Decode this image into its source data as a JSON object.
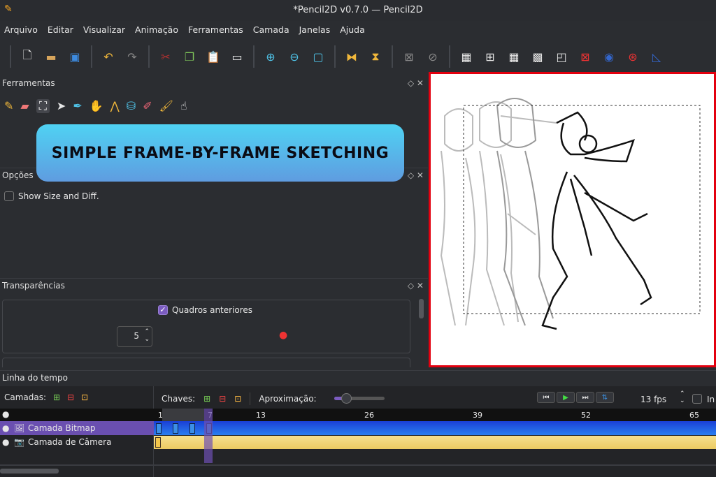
{
  "window": {
    "title": "*Pencil2D v0.7.0 — Pencil2D"
  },
  "menu": [
    "Arquivo",
    "Editar",
    "Visualizar",
    "Animação",
    "Ferramentas",
    "Camada",
    "Janelas",
    "Ajuda"
  ],
  "panels": {
    "tools": "Ferramentas",
    "options": "Opções",
    "transparency": "Transparências",
    "timeline": "Linha do tempo"
  },
  "banner": "SIMPLE FRAME-BY-FRAME SKETCHING",
  "options": {
    "show_size_diff": "Show Size and Diff."
  },
  "transparency": {
    "prev_frames": "Quadros anteriores",
    "prev_count": "5"
  },
  "timeline": {
    "layers_label": "Camadas:",
    "keys_label": "Chaves:",
    "zoom_label": "Aproximação:",
    "fps": "13 fps",
    "in_label": "In",
    "ruler": [
      "1",
      "7",
      "13",
      "26",
      "39",
      "52",
      "65"
    ],
    "layers": [
      "Camada Bitmap",
      "Camada de Câmera"
    ],
    "current_frame": 7,
    "zoom_level": 0.15
  },
  "colors": {
    "accent": "#7b5cc0",
    "bitmap": "#1f62e8",
    "camera": "#f3d679",
    "border": "#e3000f"
  }
}
